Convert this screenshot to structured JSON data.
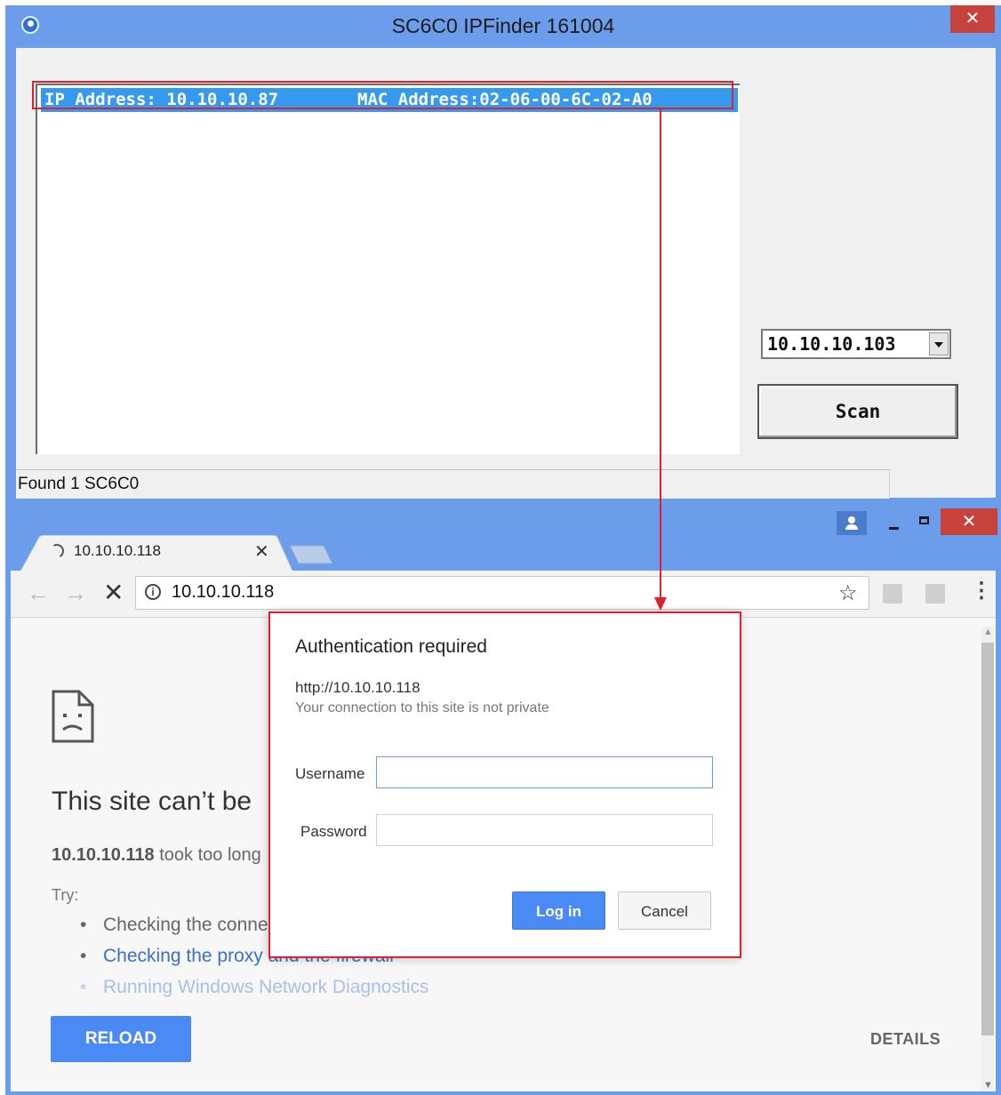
{
  "ipfinder": {
    "title": "SC6C0 IPFinder 161004",
    "close_glyph": "✕",
    "list": {
      "rows": [
        {
          "ip": "IP Address: 10.10.10.87",
          "mac": "MAC Address:02-06-00-6C-02-A0"
        }
      ]
    },
    "ip_select_value": "10.10.10.103",
    "scan_label": "Scan",
    "status": "Found 1 SC6C0"
  },
  "browser": {
    "tab_title": "10.10.10.118",
    "tab_close_glyph": "✕",
    "close_glyph": "✕",
    "address": "10.10.10.118",
    "icons": {
      "back": "←",
      "forward": "→",
      "stop": "✕",
      "info": "i",
      "star": "☆",
      "menu": "⋮"
    },
    "error": {
      "title": "This site can’t be",
      "host": "10.10.10.118",
      "detail_rest": " took too long",
      "try_label": "Try:",
      "suggestions": [
        "Checking the conne",
        "Checking the proxy and the firewall",
        "Running Windows Network Diagnostics"
      ],
      "reload_label": "RELOAD",
      "details_label": "DETAILS"
    }
  },
  "auth_dialog": {
    "title": "Authentication required",
    "url": "http://10.10.10.118",
    "subtitle": "Your connection to this site is not private",
    "username_label": "Username",
    "username_value": "",
    "password_label": "Password",
    "password_value": "",
    "login_label": "Log in",
    "cancel_label": "Cancel"
  },
  "colors": {
    "titlebar": "#6b9dea",
    "selection": "#3599ee",
    "close_red": "#c7423b",
    "accent_blue": "#4a8af4",
    "annotation_red": "#e0202a"
  }
}
